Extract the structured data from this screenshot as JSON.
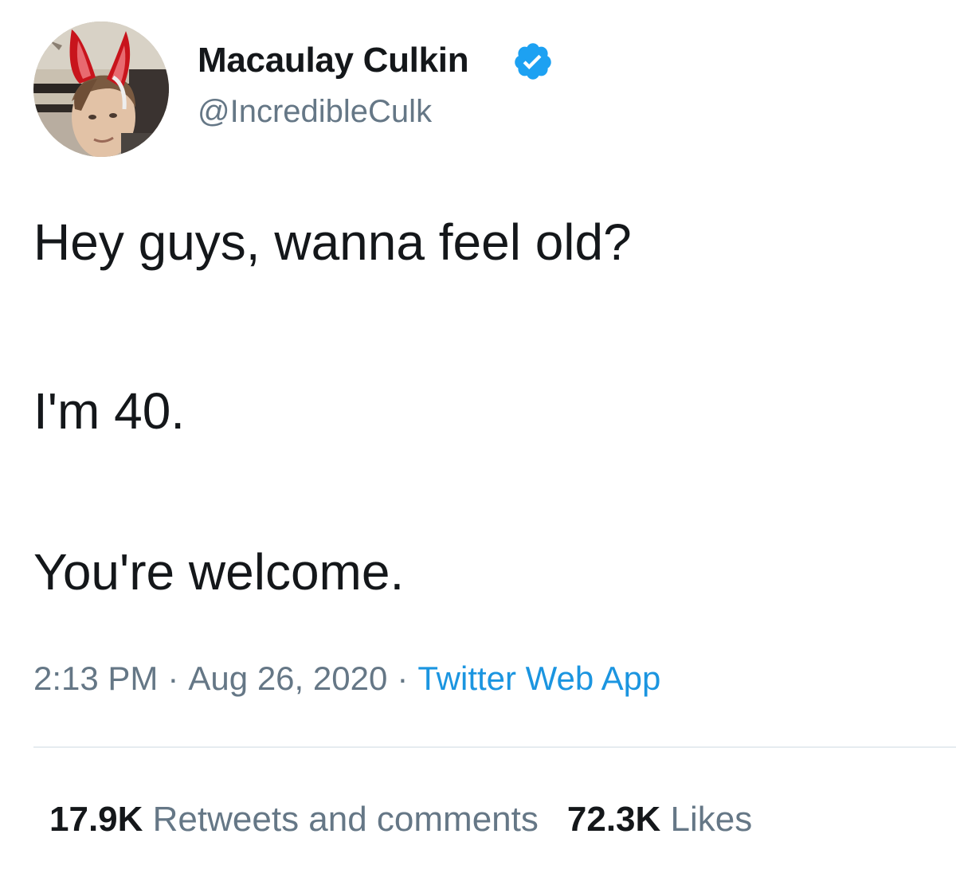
{
  "author": {
    "name": "Macaulay Culkin",
    "handle": "@IncredibleCulk",
    "verified": true,
    "avatar_icon": "profile-photo-bunny-ears"
  },
  "tweet": {
    "lines": [
      "Hey guys, wanna feel old?",
      "I'm 40.",
      "You're welcome."
    ],
    "time": "2:13 PM",
    "date": "Aug 26, 2020",
    "separator": "·",
    "source": "Twitter Web App"
  },
  "stats": {
    "retweets_count": "17.9K",
    "retweets_label": "Retweets and comments",
    "likes_count": "72.3K",
    "likes_label": "Likes"
  },
  "colors": {
    "text_primary": "#14171a",
    "text_secondary": "#657786",
    "link": "#1b95e0",
    "verified": "#1da1f2",
    "divider": "#e6ecf0"
  }
}
